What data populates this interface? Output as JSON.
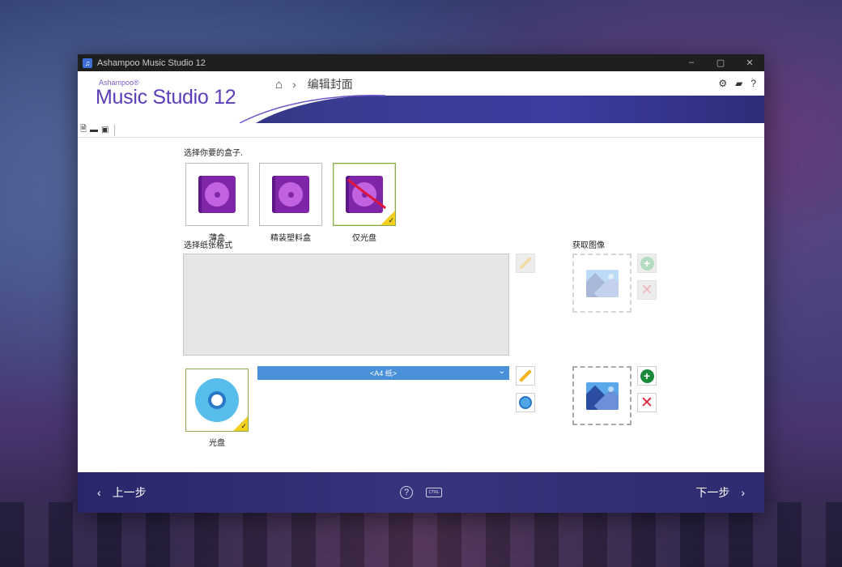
{
  "window": {
    "title": "Ashampoo Music Studio 12",
    "controls": [
      "–",
      "▢",
      "✕"
    ]
  },
  "header": {
    "logo_small": "Ashampoo®",
    "logo_big": "Music Studio 12",
    "breadcrumb": {
      "current": "编辑封面"
    },
    "right_icons": [
      "gear-icon",
      "notes-icon",
      "help-icon"
    ],
    "help_symbol": "?"
  },
  "toolbar": {
    "icons": [
      "new-file-icon",
      "open-folder-icon",
      "save-icon"
    ]
  },
  "case_section": {
    "label": "选择你要的盒子.",
    "options": [
      {
        "label": "薄盒",
        "selected": false
      },
      {
        "label": "精装塑料盒",
        "selected": false
      },
      {
        "label": "仅光盘",
        "selected": true
      }
    ]
  },
  "paper_section": {
    "label": "选择纸张格式",
    "select_value": "<A4 纸>"
  },
  "image_section": {
    "label": "获取图像"
  },
  "disc": {
    "label": "光盘"
  },
  "colors": {
    "accent_blue": "#4a90d9",
    "brand_purple": "#5b3db8",
    "case_purple": "#7e25a8",
    "check_yellow": "#f2d01e",
    "footer_bg": "#2f2b70"
  },
  "footer": {
    "prev_label": "上一步",
    "next_label": "下一步",
    "ctrl_key": "CTRL"
  }
}
